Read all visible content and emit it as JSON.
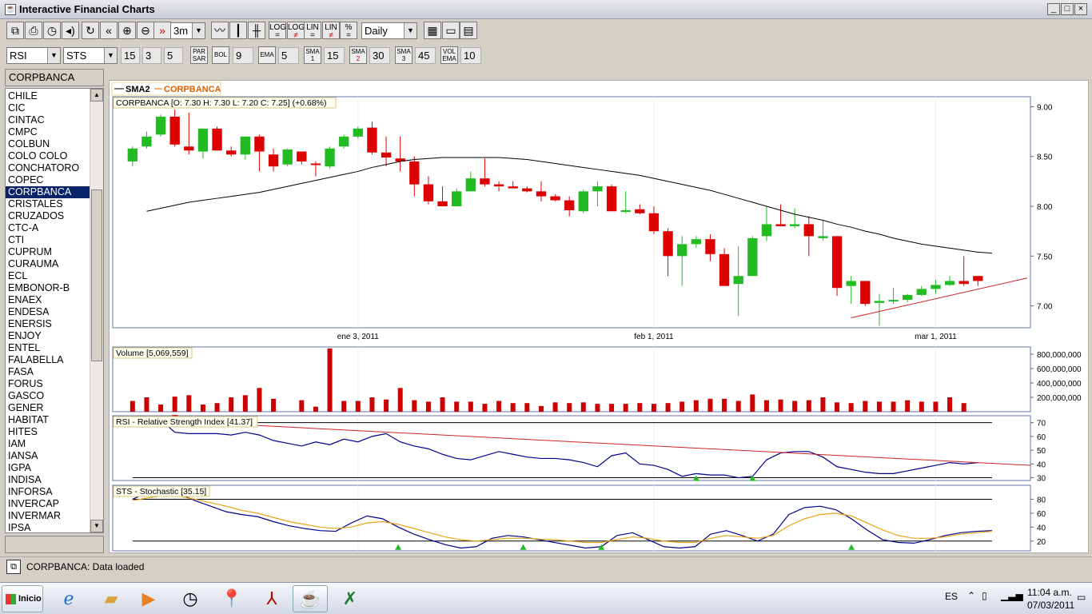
{
  "window": {
    "title": "Interactive Financial Charts",
    "buttons": [
      "_",
      "□",
      "×"
    ]
  },
  "toolbar1": {
    "interval": "3m",
    "period": "Daily",
    "scale_buttons": [
      {
        "top": "LOG",
        "bottom": "="
      },
      {
        "top": "LOG",
        "bottom": "≠"
      },
      {
        "top": "LIN",
        "bottom": "="
      },
      {
        "top": "LIN",
        "bottom": "≠"
      },
      {
        "top": "%",
        "bottom": "="
      }
    ]
  },
  "toolbar2": {
    "indicator1": "RSI",
    "indicator2": "STS",
    "params1": [
      "15",
      "3",
      "5"
    ],
    "parsar": {
      "top": "PAR",
      "bottom": "SAR"
    },
    "bol": "BOL",
    "bol_val": "9",
    "ema": "EMA",
    "ema_val": "5",
    "sma1": {
      "top": "SMA",
      "bottom": "1",
      "val": "15"
    },
    "sma2": {
      "top": "SMA",
      "bottom": "2",
      "val": "30"
    },
    "sma3": {
      "top": "SMA",
      "bottom": "3",
      "val": "45"
    },
    "volema": {
      "top": "VOL",
      "bottom": "EMA",
      "val": "10"
    }
  },
  "symbols": {
    "selected_header": "CORPBANCA",
    "items": [
      "CHILE",
      "CIC",
      "CINTAC",
      "CMPC",
      "COLBUN",
      "COLO COLO",
      "CONCHATORO",
      "COPEC",
      "CORPBANCA",
      "CRISTALES",
      "CRUZADOS",
      "CTC-A",
      "CTI",
      "CUPRUM",
      "CURAUMA",
      "ECL",
      "EMBONOR-B",
      "ENAEX",
      "ENDESA",
      "ENERSIS",
      "ENJOY",
      "ENTEL",
      "FALABELLA",
      "FASA",
      "FORUS",
      "GASCO",
      "GENER",
      "HABITAT",
      "HITES",
      "IAM",
      "IANSA",
      "IGPA",
      "INDISA",
      "INFORSA",
      "INVERCAP",
      "INVERMAR",
      "IPSA"
    ],
    "selected_index": 8
  },
  "chart_data": [
    {
      "type": "candlestick",
      "legend": [
        "SMA2",
        "CORPBANCA"
      ],
      "info": "CORPBANCA [O: 7.30  H: 7.30  L: 7.20  C: 7.25] (+0.68%)",
      "y_ticks": [
        "9.00",
        "8.50",
        "8.00",
        "7.50",
        "7.00"
      ],
      "ylim": [
        6.78,
        9.1
      ],
      "x_tick_labels": [
        {
          "label": "ene 3, 2011",
          "index": 16
        },
        {
          "label": "feb 1, 2011",
          "index": 37
        },
        {
          "label": "mar 1, 2011",
          "index": 57
        }
      ],
      "candles": [
        {
          "o": 8.45,
          "h": 8.6,
          "l": 8.4,
          "c": 8.58
        },
        {
          "o": 8.6,
          "h": 8.75,
          "l": 8.58,
          "c": 8.7
        },
        {
          "o": 8.72,
          "h": 8.92,
          "l": 8.7,
          "c": 8.9
        },
        {
          "o": 8.9,
          "h": 8.97,
          "l": 8.6,
          "c": 8.62
        },
        {
          "o": 8.6,
          "h": 8.94,
          "l": 8.52,
          "c": 8.56
        },
        {
          "o": 8.55,
          "h": 8.78,
          "l": 8.48,
          "c": 8.78
        },
        {
          "o": 8.78,
          "h": 8.8,
          "l": 8.56,
          "c": 8.56
        },
        {
          "o": 8.56,
          "h": 8.6,
          "l": 8.5,
          "c": 8.52
        },
        {
          "o": 8.52,
          "h": 8.7,
          "l": 8.47,
          "c": 8.7
        },
        {
          "o": 8.7,
          "h": 8.72,
          "l": 8.35,
          "c": 8.55
        },
        {
          "o": 8.52,
          "h": 8.58,
          "l": 8.35,
          "c": 8.4
        },
        {
          "o": 8.42,
          "h": 8.58,
          "l": 8.4,
          "c": 8.57
        },
        {
          "o": 8.55,
          "h": 8.55,
          "l": 8.42,
          "c": 8.45
        },
        {
          "o": 8.43,
          "h": 8.45,
          "l": 8.3,
          "c": 8.42
        },
        {
          "o": 8.4,
          "h": 8.6,
          "l": 8.38,
          "c": 8.58
        },
        {
          "o": 8.6,
          "h": 8.72,
          "l": 8.58,
          "c": 8.7
        },
        {
          "o": 8.7,
          "h": 8.8,
          "l": 8.68,
          "c": 8.78
        },
        {
          "o": 8.79,
          "h": 8.85,
          "l": 8.52,
          "c": 8.54
        },
        {
          "o": 8.54,
          "h": 8.7,
          "l": 8.4,
          "c": 8.49
        },
        {
          "o": 8.48,
          "h": 8.7,
          "l": 8.35,
          "c": 8.45
        },
        {
          "o": 8.45,
          "h": 8.5,
          "l": 8.1,
          "c": 8.22
        },
        {
          "o": 8.22,
          "h": 8.3,
          "l": 8.02,
          "c": 8.05
        },
        {
          "o": 8.05,
          "h": 8.2,
          "l": 8.0,
          "c": 8.0
        },
        {
          "o": 8.0,
          "h": 8.18,
          "l": 8.0,
          "c": 8.15
        },
        {
          "o": 8.15,
          "h": 8.35,
          "l": 8.15,
          "c": 8.28
        },
        {
          "o": 8.28,
          "h": 8.48,
          "l": 8.2,
          "c": 8.22
        },
        {
          "o": 8.22,
          "h": 8.25,
          "l": 8.15,
          "c": 8.2
        },
        {
          "o": 8.2,
          "h": 8.25,
          "l": 8.18,
          "c": 8.18
        },
        {
          "o": 8.18,
          "h": 8.2,
          "l": 8.14,
          "c": 8.15
        },
        {
          "o": 8.15,
          "h": 8.25,
          "l": 8.05,
          "c": 8.1
        },
        {
          "o": 8.1,
          "h": 8.12,
          "l": 8.05,
          "c": 8.06
        },
        {
          "o": 8.06,
          "h": 8.1,
          "l": 7.9,
          "c": 7.96
        },
        {
          "o": 7.95,
          "h": 8.17,
          "l": 7.93,
          "c": 8.15
        },
        {
          "o": 8.15,
          "h": 8.25,
          "l": 8.0,
          "c": 8.2
        },
        {
          "o": 8.2,
          "h": 8.22,
          "l": 7.95,
          "c": 7.95
        },
        {
          "o": 7.95,
          "h": 8.15,
          "l": 7.93,
          "c": 7.96
        },
        {
          "o": 7.97,
          "h": 8.02,
          "l": 7.92,
          "c": 7.93
        },
        {
          "o": 7.93,
          "h": 8.0,
          "l": 7.72,
          "c": 7.75
        },
        {
          "o": 7.75,
          "h": 7.78,
          "l": 7.3,
          "c": 7.5
        },
        {
          "o": 7.5,
          "h": 7.7,
          "l": 7.2,
          "c": 7.62
        },
        {
          "o": 7.62,
          "h": 7.7,
          "l": 7.58,
          "c": 7.67
        },
        {
          "o": 7.67,
          "h": 7.72,
          "l": 7.45,
          "c": 7.52
        },
        {
          "o": 7.52,
          "h": 7.58,
          "l": 7.2,
          "c": 7.2
        },
        {
          "o": 7.22,
          "h": 7.6,
          "l": 6.9,
          "c": 7.3
        },
        {
          "o": 7.3,
          "h": 7.7,
          "l": 7.3,
          "c": 7.68
        },
        {
          "o": 7.7,
          "h": 8.0,
          "l": 7.65,
          "c": 7.82
        },
        {
          "o": 7.82,
          "h": 8.02,
          "l": 7.8,
          "c": 7.8
        },
        {
          "o": 7.8,
          "h": 7.98,
          "l": 7.78,
          "c": 7.82
        },
        {
          "o": 7.82,
          "h": 7.9,
          "l": 7.5,
          "c": 7.7
        },
        {
          "o": 7.68,
          "h": 7.86,
          "l": 7.66,
          "c": 7.7
        },
        {
          "o": 7.7,
          "h": 7.7,
          "l": 7.1,
          "c": 7.18
        },
        {
          "o": 7.2,
          "h": 7.3,
          "l": 7.02,
          "c": 7.25
        },
        {
          "o": 7.25,
          "h": 7.25,
          "l": 7.0,
          "c": 7.02
        },
        {
          "o": 7.03,
          "h": 7.12,
          "l": 6.8,
          "c": 7.05
        },
        {
          "o": 7.05,
          "h": 7.18,
          "l": 7.02,
          "c": 7.06
        },
        {
          "o": 7.06,
          "h": 7.12,
          "l": 7.04,
          "c": 7.11
        },
        {
          "o": 7.11,
          "h": 7.2,
          "l": 7.1,
          "c": 7.17
        },
        {
          "o": 7.17,
          "h": 7.26,
          "l": 7.12,
          "c": 7.21
        },
        {
          "o": 7.21,
          "h": 7.3,
          "l": 7.2,
          "c": 7.25
        },
        {
          "o": 7.25,
          "h": 7.5,
          "l": 7.2,
          "c": 7.22
        },
        {
          "o": 7.3,
          "h": 7.3,
          "l": 7.2,
          "c": 7.25
        }
      ],
      "sma": [
        7.95,
        7.98,
        8.01,
        8.04,
        8.06,
        8.08,
        8.1,
        8.12,
        8.14,
        8.17,
        8.2,
        8.23,
        8.26,
        8.29,
        8.32,
        8.35,
        8.39,
        8.42,
        8.45,
        8.47,
        8.48,
        8.49,
        8.49,
        8.49,
        8.49,
        8.49,
        8.48,
        8.47,
        8.45,
        8.43,
        8.41,
        8.39,
        8.37,
        8.35,
        8.33,
        8.31,
        8.28,
        8.25,
        8.22,
        8.19,
        8.16,
        8.12,
        8.08,
        8.04,
        8.0,
        7.96,
        7.92,
        7.89,
        7.86,
        7.82,
        7.79,
        7.75,
        7.72,
        7.68,
        7.65,
        7.62,
        7.6,
        7.58,
        7.56,
        7.54,
        7.53
      ],
      "trendline": {
        "from": {
          "index": 51,
          "value": 6.88
        },
        "to": {
          "index": 63.5,
          "value": 7.28
        }
      },
      "up_color": "#22bb22",
      "down_color": "#dd0000"
    },
    {
      "type": "bar",
      "title": "Volume [5,069,559]",
      "y_ticks": [
        "800,000,000",
        "600,000,000",
        "400,000,000",
        "200,000,000"
      ],
      "ylim": [
        0,
        900000000
      ],
      "values": [
        150,
        200,
        100,
        210,
        230,
        100,
        120,
        200,
        230,
        330,
        180,
        0,
        160,
        70,
        880,
        150,
        150,
        200,
        170,
        330,
        160,
        140,
        200,
        140,
        140,
        110,
        150,
        120,
        120,
        80,
        130,
        120,
        130,
        110,
        110,
        110,
        120,
        110,
        120,
        140,
        160,
        180,
        180,
        150,
        240,
        160,
        170,
        150,
        160,
        200,
        130,
        120,
        150,
        140,
        140,
        160,
        140,
        140,
        200,
        120
      ],
      "values_unit": "millions",
      "color": "#cc0000"
    },
    {
      "type": "line",
      "title": "RSI - Relative Strength Index [41.37]",
      "y_ticks": [
        "70",
        "60",
        "50",
        "40",
        "30"
      ],
      "ylim": [
        28,
        75
      ],
      "levels": [
        70,
        30
      ],
      "values": [
        70,
        71,
        72,
        63,
        62,
        62,
        62,
        61,
        63,
        61,
        57,
        55,
        53,
        56,
        54,
        58,
        56,
        60,
        62,
        56,
        53,
        51,
        47,
        44,
        43,
        46,
        49,
        47,
        45,
        44,
        44,
        43,
        41,
        38,
        46,
        48,
        40,
        39,
        36,
        31,
        33,
        32,
        32,
        30,
        31,
        43,
        48,
        49,
        49,
        45,
        38,
        36,
        34,
        33,
        33,
        35,
        37,
        39,
        41,
        40,
        41
      ],
      "signals": [
        {
          "index": 3,
          "dir": "down"
        },
        {
          "index": 40,
          "dir": "up"
        },
        {
          "index": 44,
          "dir": "up"
        }
      ],
      "trendline": {
        "from": {
          "index": 3,
          "value": 71
        },
        "to": {
          "index": 63,
          "value": 39
        }
      },
      "color": "#00008b"
    },
    {
      "type": "line",
      "title": "STS - Stochastic [35.15]",
      "y_ticks": [
        "80",
        "60",
        "40",
        "20"
      ],
      "ylim": [
        6,
        100
      ],
      "levels": [
        80,
        20
      ],
      "series": [
        {
          "values": [
            80,
            90,
            92,
            88,
            78,
            70,
            62,
            58,
            55,
            48,
            42,
            38,
            35,
            34,
            46,
            56,
            52,
            40,
            30,
            22,
            15,
            10,
            12,
            24,
            28,
            26,
            22,
            18,
            14,
            10,
            12,
            28,
            32,
            22,
            12,
            10,
            12,
            30,
            35,
            28,
            20,
            30,
            58,
            68,
            70,
            65,
            52,
            36,
            22,
            18,
            17,
            22,
            28,
            32,
            34,
            35
          ],
          "color": "#00008b"
        },
        {
          "values": [
            78,
            82,
            85,
            84,
            80,
            75,
            70,
            64,
            60,
            54,
            48,
            44,
            40,
            38,
            40,
            46,
            48,
            44,
            38,
            32,
            26,
            22,
            20,
            22,
            24,
            24,
            23,
            22,
            20,
            18,
            18,
            22,
            26,
            24,
            20,
            18,
            18,
            24,
            28,
            26,
            24,
            28,
            42,
            52,
            58,
            60,
            56,
            46,
            36,
            28,
            24,
            24,
            26,
            30,
            32,
            34
          ],
          "color": "#e8a317"
        }
      ],
      "signals": [
        {
          "index": 16,
          "dir": "up"
        },
        {
          "index": 22,
          "dir": "up"
        },
        {
          "index": 27,
          "dir": "up"
        },
        {
          "index": 40,
          "dir": "up"
        },
        {
          "index": 2,
          "dir": "down"
        }
      ],
      "markers": [
        {
          "index": 3,
          "dir": "down"
        },
        {
          "index": 17,
          "dir": "up"
        },
        {
          "index": 25,
          "dir": "up"
        },
        {
          "index": 30,
          "dir": "up"
        },
        {
          "index": 46,
          "dir": "up"
        }
      ]
    }
  ],
  "status": {
    "text": "CORPBANCA: Data loaded"
  },
  "taskbar": {
    "start_label": "Inicio",
    "lang": "ES",
    "time": "11:04 a.m.",
    "date": "07/03/2011"
  }
}
